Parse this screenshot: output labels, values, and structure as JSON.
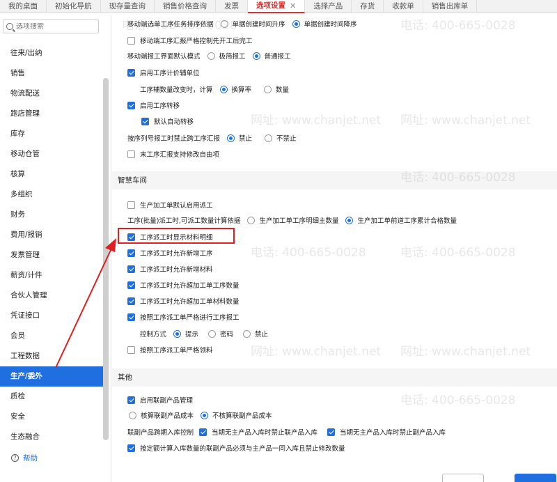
{
  "tabs": [
    {
      "label": "我的桌面",
      "active": false
    },
    {
      "label": "初始化导航",
      "active": false
    },
    {
      "label": "现存量查询",
      "active": false
    },
    {
      "label": "销售价格查询",
      "active": false
    },
    {
      "label": "发票",
      "active": false
    },
    {
      "label": "选项设置",
      "active": true
    },
    {
      "label": "选择产品",
      "active": false
    },
    {
      "label": "存货",
      "active": false
    },
    {
      "label": "收款单",
      "active": false
    },
    {
      "label": "销售出库单",
      "active": false
    }
  ],
  "search": {
    "placeholder": "选项搜索"
  },
  "sidebar": {
    "items": [
      "往来/出纳",
      "销售",
      "物流配送",
      "跑店管理",
      "库存",
      "移动仓管",
      "核算",
      "多组织",
      "财务",
      "费用/报销",
      "发票管理",
      "薪资/计件",
      "合伙人管理",
      "凭证接口",
      "会员",
      "工程数据",
      "生产/委外",
      "质检",
      "安全",
      "生态融合"
    ],
    "active_index": 16,
    "help": "帮助"
  },
  "settings": {
    "move_sort_label": "移动端选单工序任务排序依据",
    "move_sort_opt1": "单据创建时间升序",
    "move_sort_opt2": "单据创建时间降序",
    "strict_control": "移动端工序汇报严格控制先开工后完工",
    "report_mode_label": "移动端报工界面默认模式",
    "report_mode_opt1": "极简报工",
    "report_mode_opt2": "普通报工",
    "aux_unit": "启用工序计价辅单位",
    "aux_change_label": "工序辅数量改变时，计算",
    "aux_change_opt1": "换算率",
    "aux_change_opt2": "数量",
    "transfer": "启用工序转移",
    "auto_transfer": "默认自动转移",
    "cross_report_label": "按序列号报工时禁止跨工序汇报",
    "cross_report_opt1": "禁止",
    "cross_report_opt2": "不禁止",
    "last_proc_edit": "末工序汇报支持修改自由项"
  },
  "smart_workshop": {
    "title": "智慧车间",
    "default_dispatch": "生产加工单默认启用派工",
    "dispatch_basis_label": "工序(批量)派工时,可派工数量计算依据",
    "dispatch_basis_opt1": "生产加工单工序明细主数量",
    "dispatch_basis_opt2": "生产加工单前道工序累计合格数量",
    "show_material": "工序派工时显示材料明细",
    "allow_add_proc": "工序派工时允许新增工序",
    "allow_add_mat": "工序派工时允许新增材料",
    "allow_exceed_proc": "工序派工时允许超加工单工序数量",
    "allow_exceed_mat": "工序派工时允许超加工单材料数量",
    "strict_report": "按照工序派工单严格进行工序报工",
    "control_label": "控制方式",
    "control_opt1": "提示",
    "control_opt2": "密码",
    "control_opt3": "禁止",
    "strict_pick": "按照工序派工单严格领料"
  },
  "others": {
    "title": "其他",
    "joint_product": "启用联副产品管理",
    "cost_opt1": "核算联副产品成本",
    "cost_opt2": "不核算联副产品成本",
    "cross_period_label": "联副产品跨期入库控制",
    "cross_opt1": "当期无主产品入库时禁止联产品入库",
    "cross_opt2": "当期无主产品入库时禁止副产品入库",
    "quota_check": "按定额计算入库数量的联副产品必须与主产品一同入库且禁止修改数量"
  },
  "watermark": {
    "phone": "电话: 400-665-0028",
    "site": "网址: www.chanjet.net"
  },
  "colors": {
    "accent": "#1f6fe0",
    "active_tab": "#e03030",
    "highlight": "#e02020"
  }
}
